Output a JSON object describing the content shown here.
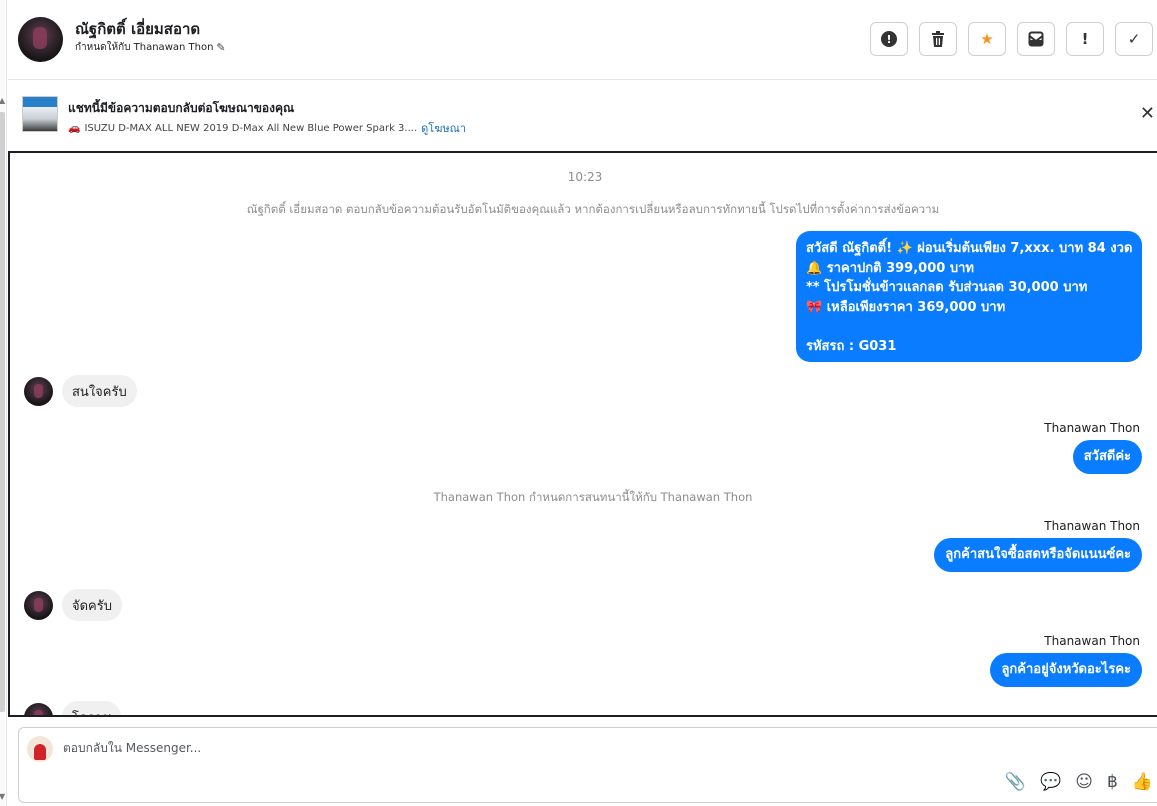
{
  "header": {
    "contact_name": "ณัฐกิตติ์ เอี่ยมสอาด",
    "assigned_to": "กำหนดให้กับ Thanawan Thon",
    "actions": [
      {
        "name": "alert-circle-icon",
        "glyph": "!"
      },
      {
        "name": "trash-icon",
        "glyph": "🗑"
      },
      {
        "name": "star-icon",
        "glyph": "★"
      },
      {
        "name": "mark-unread-icon",
        "glyph": "✉"
      },
      {
        "name": "exclamation-icon",
        "glyph": "!"
      },
      {
        "name": "checkmark-icon",
        "glyph": "✓"
      }
    ]
  },
  "ad": {
    "title": "แชทนี้มีข้อความตอบกลับต่อโฆษณาของคุณ",
    "product": "ISUZU D-MAX ALL NEW 2019 D-Max All New Blue Power Spark 3....",
    "view_link": "ดูโฆษณา"
  },
  "conversation": {
    "time": "10:23",
    "auto_reply_notice": "ณัฐกิตติ์ เอี่ยมสอาด ตอบกลับข้อความต้อนรับอัตโนมัติของคุณแล้ว หากต้องการเปลี่ยนหรือลบการทักทายนี้ โปรดไปที่การตั้งค่าการส่งข้อความ",
    "promo_lines": [
      "สวัสดี ณัฐกิตติ์! ✨  ผ่อนเริ่มต้นเพียง 7,xxx. บาท 84 งวด",
      "🔔 ราคาปกติ 399,000 บาท",
      "** โปรโมชั่นข้าวแลกลด รับส่วนลด 30,000 บาท",
      "🎀  เหลือเพียงราคา 369,000 บาท",
      "",
      "รหัสรถ : G031"
    ],
    "in_msg_1": "สนใจครับ",
    "sender_1": "Thanawan Thon",
    "out_msg_1": "สวัสดีค่ะ",
    "assign_notice": "Thanawan Thon กำหนดการสนทนานี้ให้กับ Thanawan Thon",
    "sender_2": "Thanawan Thon",
    "out_msg_2": "ลูกค้าสนใจซื้อสดหรือจัดแนนซ์คะ",
    "in_msg_2": "จัดครับ",
    "sender_3": "Thanawan Thon",
    "out_msg_3": "ลูกค้าอยู่จังหวัดอะไรคะ",
    "in_msg_3_partial": "โคราช"
  },
  "composer": {
    "placeholder": "ตอบกลับใน Messenger..."
  },
  "colors": {
    "outgoing_bubble": "#0a7cff",
    "incoming_bubble": "#f0f0f0",
    "star": "#f7931e",
    "link": "#1a6fb5"
  }
}
